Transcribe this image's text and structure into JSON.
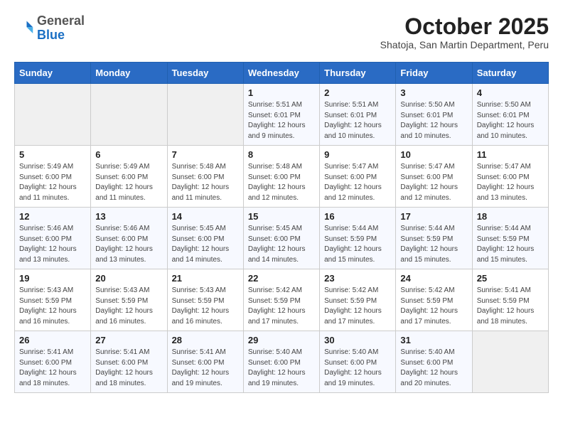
{
  "logo": {
    "general": "General",
    "blue": "Blue"
  },
  "header": {
    "month": "October 2025",
    "location": "Shatoja, San Martin Department, Peru"
  },
  "weekdays": [
    "Sunday",
    "Monday",
    "Tuesday",
    "Wednesday",
    "Thursday",
    "Friday",
    "Saturday"
  ],
  "rows": [
    [
      {
        "day": "",
        "info": ""
      },
      {
        "day": "",
        "info": ""
      },
      {
        "day": "",
        "info": ""
      },
      {
        "day": "1",
        "info": "Sunrise: 5:51 AM\nSunset: 6:01 PM\nDaylight: 12 hours\nand 9 minutes."
      },
      {
        "day": "2",
        "info": "Sunrise: 5:51 AM\nSunset: 6:01 PM\nDaylight: 12 hours\nand 10 minutes."
      },
      {
        "day": "3",
        "info": "Sunrise: 5:50 AM\nSunset: 6:01 PM\nDaylight: 12 hours\nand 10 minutes."
      },
      {
        "day": "4",
        "info": "Sunrise: 5:50 AM\nSunset: 6:01 PM\nDaylight: 12 hours\nand 10 minutes."
      }
    ],
    [
      {
        "day": "5",
        "info": "Sunrise: 5:49 AM\nSunset: 6:00 PM\nDaylight: 12 hours\nand 11 minutes."
      },
      {
        "day": "6",
        "info": "Sunrise: 5:49 AM\nSunset: 6:00 PM\nDaylight: 12 hours\nand 11 minutes."
      },
      {
        "day": "7",
        "info": "Sunrise: 5:48 AM\nSunset: 6:00 PM\nDaylight: 12 hours\nand 11 minutes."
      },
      {
        "day": "8",
        "info": "Sunrise: 5:48 AM\nSunset: 6:00 PM\nDaylight: 12 hours\nand 12 minutes."
      },
      {
        "day": "9",
        "info": "Sunrise: 5:47 AM\nSunset: 6:00 PM\nDaylight: 12 hours\nand 12 minutes."
      },
      {
        "day": "10",
        "info": "Sunrise: 5:47 AM\nSunset: 6:00 PM\nDaylight: 12 hours\nand 12 minutes."
      },
      {
        "day": "11",
        "info": "Sunrise: 5:47 AM\nSunset: 6:00 PM\nDaylight: 12 hours\nand 13 minutes."
      }
    ],
    [
      {
        "day": "12",
        "info": "Sunrise: 5:46 AM\nSunset: 6:00 PM\nDaylight: 12 hours\nand 13 minutes."
      },
      {
        "day": "13",
        "info": "Sunrise: 5:46 AM\nSunset: 6:00 PM\nDaylight: 12 hours\nand 13 minutes."
      },
      {
        "day": "14",
        "info": "Sunrise: 5:45 AM\nSunset: 6:00 PM\nDaylight: 12 hours\nand 14 minutes."
      },
      {
        "day": "15",
        "info": "Sunrise: 5:45 AM\nSunset: 6:00 PM\nDaylight: 12 hours\nand 14 minutes."
      },
      {
        "day": "16",
        "info": "Sunrise: 5:44 AM\nSunset: 5:59 PM\nDaylight: 12 hours\nand 15 minutes."
      },
      {
        "day": "17",
        "info": "Sunrise: 5:44 AM\nSunset: 5:59 PM\nDaylight: 12 hours\nand 15 minutes."
      },
      {
        "day": "18",
        "info": "Sunrise: 5:44 AM\nSunset: 5:59 PM\nDaylight: 12 hours\nand 15 minutes."
      }
    ],
    [
      {
        "day": "19",
        "info": "Sunrise: 5:43 AM\nSunset: 5:59 PM\nDaylight: 12 hours\nand 16 minutes."
      },
      {
        "day": "20",
        "info": "Sunrise: 5:43 AM\nSunset: 5:59 PM\nDaylight: 12 hours\nand 16 minutes."
      },
      {
        "day": "21",
        "info": "Sunrise: 5:43 AM\nSunset: 5:59 PM\nDaylight: 12 hours\nand 16 minutes."
      },
      {
        "day": "22",
        "info": "Sunrise: 5:42 AM\nSunset: 5:59 PM\nDaylight: 12 hours\nand 17 minutes."
      },
      {
        "day": "23",
        "info": "Sunrise: 5:42 AM\nSunset: 5:59 PM\nDaylight: 12 hours\nand 17 minutes."
      },
      {
        "day": "24",
        "info": "Sunrise: 5:42 AM\nSunset: 5:59 PM\nDaylight: 12 hours\nand 17 minutes."
      },
      {
        "day": "25",
        "info": "Sunrise: 5:41 AM\nSunset: 5:59 PM\nDaylight: 12 hours\nand 18 minutes."
      }
    ],
    [
      {
        "day": "26",
        "info": "Sunrise: 5:41 AM\nSunset: 6:00 PM\nDaylight: 12 hours\nand 18 minutes."
      },
      {
        "day": "27",
        "info": "Sunrise: 5:41 AM\nSunset: 6:00 PM\nDaylight: 12 hours\nand 18 minutes."
      },
      {
        "day": "28",
        "info": "Sunrise: 5:41 AM\nSunset: 6:00 PM\nDaylight: 12 hours\nand 19 minutes."
      },
      {
        "day": "29",
        "info": "Sunrise: 5:40 AM\nSunset: 6:00 PM\nDaylight: 12 hours\nand 19 minutes."
      },
      {
        "day": "30",
        "info": "Sunrise: 5:40 AM\nSunset: 6:00 PM\nDaylight: 12 hours\nand 19 minutes."
      },
      {
        "day": "31",
        "info": "Sunrise: 5:40 AM\nSunset: 6:00 PM\nDaylight: 12 hours\nand 20 minutes."
      },
      {
        "day": "",
        "info": ""
      }
    ]
  ]
}
